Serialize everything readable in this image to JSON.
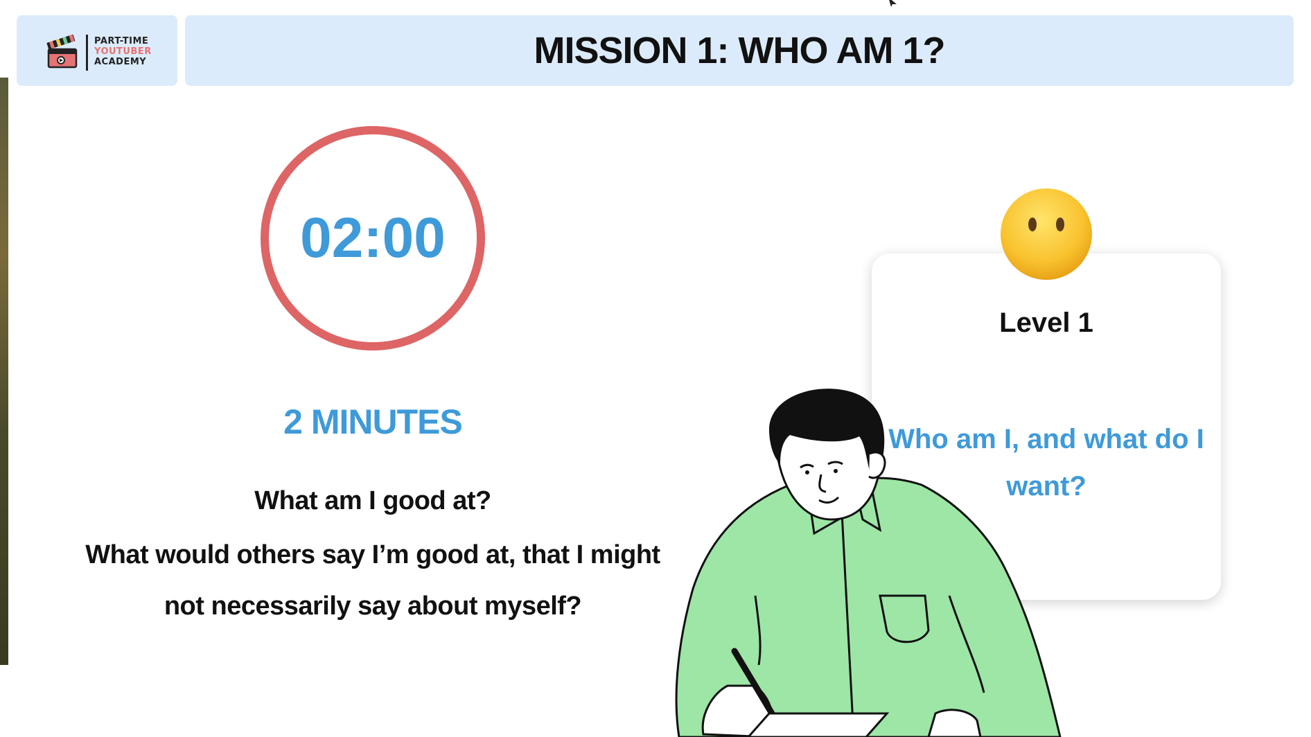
{
  "header": {
    "logo": {
      "line1": "PART-TIME",
      "line2": "YOUTUBER",
      "line3": "ACADEMY"
    },
    "title": "MISSION 1: WHO AM 1?"
  },
  "timer": {
    "time": "02:00",
    "ring_color": "#dd6565",
    "text_color": "#3f9ad9"
  },
  "duration_label": "2 MINUTES",
  "questions": [
    "What am I good at?",
    "What would others say I’m good at, that I might",
    "not necessarily say about myself?"
  ],
  "level_card": {
    "title": "Level 1",
    "question": "Who am I, and what do I want?",
    "emoji_icon": "neutral-face-icon"
  },
  "illustration": {
    "icon": "person-writing-icon",
    "shirt_color": "#9de6a6"
  },
  "colors": {
    "header_bg": "#dcebfb",
    "accent_blue": "#3f9ad9",
    "ring_red": "#dd6565"
  }
}
